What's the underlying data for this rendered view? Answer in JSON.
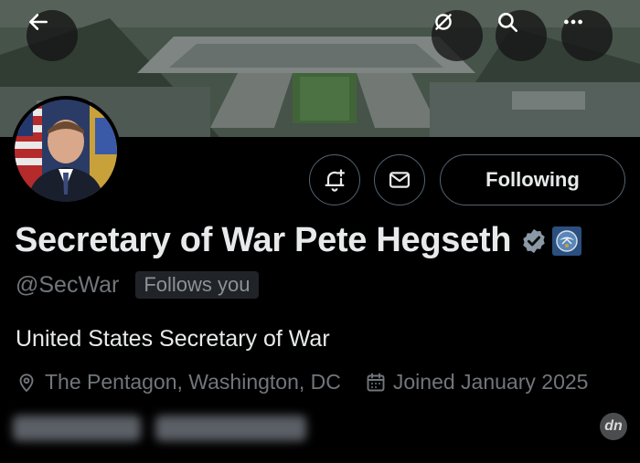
{
  "profile": {
    "display_name": "Secretary of War Pete Hegseth",
    "handle": "@SecWar",
    "follows_you_label": "Follows you",
    "bio": "United States Secretary of War",
    "location": "The Pentagon, Washington, DC",
    "joined": "Joined January 2025",
    "verified_badge_color": "#8b98a5"
  },
  "actions": {
    "following_label": "Following"
  },
  "icons": {
    "back": "arrow-left-icon",
    "hide": "eye-slash-icon",
    "search": "search-icon",
    "more": "more-horizontal-icon",
    "notify": "bell-plus-icon",
    "message": "envelope-icon",
    "location": "map-pin-icon",
    "calendar": "calendar-icon"
  },
  "watermark": {
    "text": "dn"
  },
  "colors": {
    "background": "#000000",
    "primary_text": "#e7e9ea",
    "secondary_text": "#71767b",
    "border": "#536471"
  }
}
